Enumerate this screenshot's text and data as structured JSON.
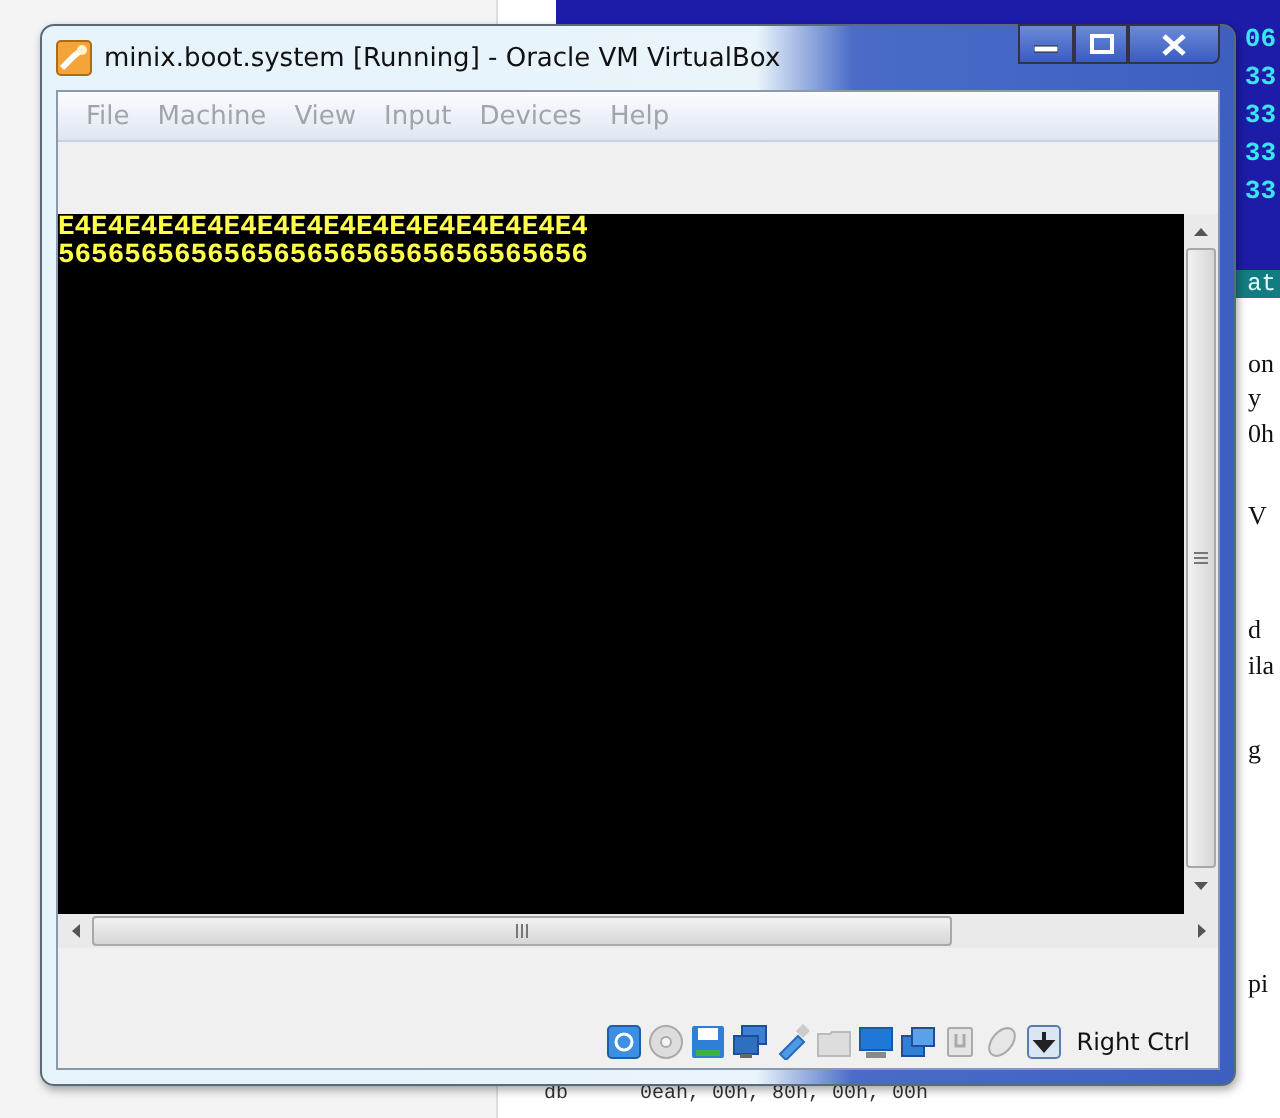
{
  "window": {
    "title": "minix.boot.system [Running] - Oracle VM VirtualBox"
  },
  "menu": [
    "File",
    "Machine",
    "View",
    "Input",
    "Devices",
    "Help"
  ],
  "screen": {
    "lines": [
      "E4E4E4E4E4E4E4E4E4E4E4E4E4E4E4E4",
      "56565656565656565656565656565656"
    ]
  },
  "status_bar": {
    "host_key": "Right Ctrl"
  },
  "background": {
    "hex_fragments": [
      "06",
      "33",
      "33",
      "33",
      "33"
    ],
    "strip_text": "at",
    "doc_fragments": [
      "on",
      "y",
      "0h",
      "V",
      "d",
      "ila",
      "g",
      "pi"
    ],
    "code_line": {
      "keyword": "db",
      "operands": "0eah, 00h, 80h, 00h, 00h"
    }
  }
}
